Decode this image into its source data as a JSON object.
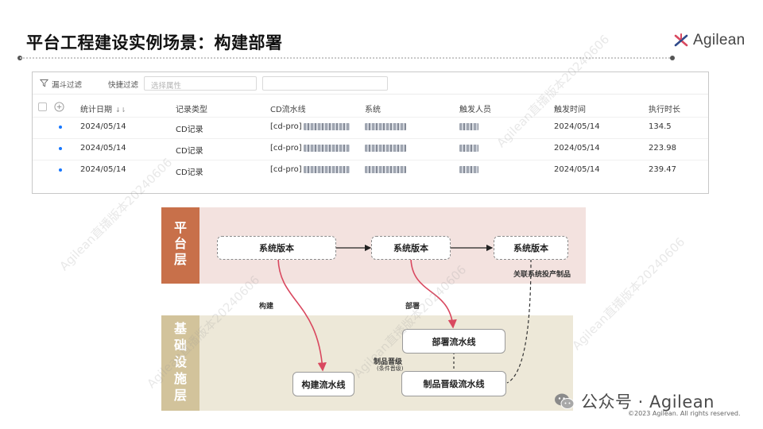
{
  "slide": {
    "title": "平台工程建设实例场景：构建部署",
    "logo_text": "Agilean"
  },
  "filter_bar": {
    "funnel_label": "漏斗过滤",
    "quick_filter_label": "快捷过滤",
    "attribute_placeholder": "选择属性",
    "value_placeholder": ""
  },
  "table": {
    "columns": [
      "统计日期",
      "记录类型",
      "CD流水线",
      "系统",
      "触发人员",
      "触发时间",
      "执行时长"
    ],
    "rows": [
      {
        "date": "2024/05/14",
        "type": "CD记录",
        "cd_prefix": "[cd-pro]",
        "trigger_time": "2024/05/14",
        "duration": "134.5"
      },
      {
        "date": "2024/05/14",
        "type": "CD记录",
        "cd_prefix": "[cd-pro]",
        "trigger_time": "2024/05/14",
        "duration": "223.98"
      },
      {
        "date": "2024/05/14",
        "type": "CD记录",
        "cd_prefix": "[cd-pro]",
        "trigger_time": "2024/05/14",
        "duration": "239.47"
      }
    ]
  },
  "diagram": {
    "platform_layer": {
      "label_chars": [
        "平",
        "台",
        "层"
      ],
      "color": "#c8704a"
    },
    "infra_layer": {
      "label_chars": [
        "基",
        "础",
        "设",
        "施",
        "层"
      ],
      "color": "#d2c39b"
    },
    "nodes": {
      "version_1": "系统版本",
      "version_2": "系统版本",
      "version_3": "系统版本",
      "deploy_pipeline": "部署流水线",
      "build_pipeline": "构建流水线",
      "promote_pipeline": "制品晋级流水线"
    },
    "edges": {
      "build": "构建",
      "deploy": "部署",
      "promote": "制品晋级",
      "promote_condition": "(条件晋级)",
      "link_artifact": "关联系统投产制品"
    },
    "arrow_color": "#d9485f"
  },
  "footer": {
    "wechat_text": "公众号 · Agilean",
    "copyright": "©2023 Agilean. All rights reserved."
  },
  "watermarks": [
    "Agilean直播版本20240606"
  ]
}
